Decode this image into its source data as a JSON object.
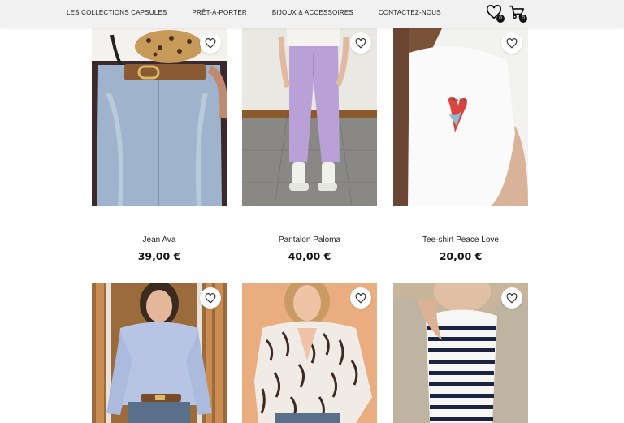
{
  "nav": {
    "items": [
      {
        "label": "LES COLLECTIONS CAPSULES"
      },
      {
        "label": "PRÊT-À-PORTER"
      },
      {
        "label": "BIJOUX & ACCESSOIRES"
      },
      {
        "label": "CONTACTEZ-NOUS"
      }
    ],
    "wishlist_count": "0",
    "cart_count": "0"
  },
  "icons": {
    "wishlist": "heart-icon",
    "cart": "shopping-cart-icon",
    "favorite": "heart-icon"
  },
  "products": [
    {
      "name": "Jean Ava",
      "price": "39,00 €"
    },
    {
      "name": "Pantalon Paloma",
      "price": "40,00 €"
    },
    {
      "name": "Tee-shirt Peace Love",
      "price": "20,00 €"
    },
    {
      "name": "",
      "price": ""
    },
    {
      "name": "",
      "price": ""
    },
    {
      "name": "",
      "price": ""
    }
  ]
}
